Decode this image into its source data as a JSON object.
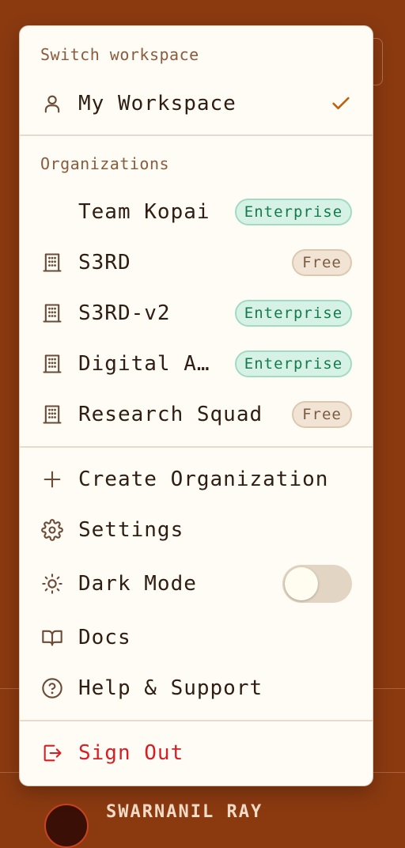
{
  "background": {
    "username": "SWARNANIL RAY"
  },
  "menu": {
    "switch_label": "Switch workspace",
    "current_workspace": "My Workspace",
    "orgs_label": "Organizations",
    "organizations": [
      {
        "name": "Team Kopai",
        "plan": "Enterprise",
        "icon": "none"
      },
      {
        "name": "S3RD",
        "plan": "Free",
        "icon": "building-icon"
      },
      {
        "name": "S3RD-v2",
        "plan": "Enterprise",
        "icon": "building-icon"
      },
      {
        "name": "Digital A…",
        "plan": "Enterprise",
        "icon": "building-icon"
      },
      {
        "name": "Research Squad",
        "plan": "Free",
        "icon": "building-icon"
      }
    ],
    "actions": {
      "create_org": "Create Organization",
      "settings": "Settings",
      "dark_mode": "Dark Mode",
      "dark_mode_enabled": false,
      "docs": "Docs",
      "help": "Help & Support",
      "sign_out": "Sign Out"
    }
  },
  "colors": {
    "accent": "#c25f0a",
    "danger": "#d61f24",
    "enterprise_text": "#157a4d",
    "free_text": "#7c5b44",
    "background": "#8b3a10"
  }
}
